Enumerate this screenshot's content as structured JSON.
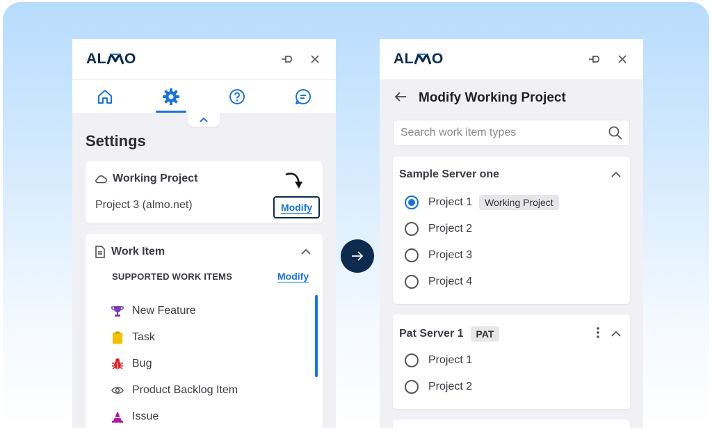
{
  "brand": {
    "logo_text_left": "AL",
    "logo_text_right": "O"
  },
  "left_panel": {
    "nav_tabs": [
      {
        "name": "home",
        "icon": "home-icon"
      },
      {
        "name": "settings",
        "icon": "gear-icon",
        "active": true
      },
      {
        "name": "help",
        "icon": "help-icon"
      },
      {
        "name": "chat",
        "icon": "chat-icon"
      }
    ],
    "page_title": "Settings",
    "working_project": {
      "header": "Working Project",
      "value": "Project 3 (almo.net)",
      "modify_label": "Modify"
    },
    "work_item": {
      "header": "Work Item",
      "supported_label": "SUPPORTED WORK ITEMS",
      "modify_label": "Modify",
      "items": [
        {
          "label": "New Feature",
          "icon": "trophy-icon",
          "color": "#7b3fb5"
        },
        {
          "label": "Task",
          "icon": "clipboard-icon",
          "color": "#f2c200"
        },
        {
          "label": "Bug",
          "icon": "bug-icon",
          "color": "#e0262b"
        },
        {
          "label": "Product Backlog Item",
          "icon": "eye-icon",
          "color": "#555555"
        },
        {
          "label": "Issue",
          "icon": "cone-icon",
          "color": "#b3179a"
        }
      ]
    }
  },
  "right_panel": {
    "title": "Modify Working Project",
    "search_placeholder": "Search work item types",
    "servers": [
      {
        "name": "Sample Server one",
        "projects": [
          {
            "label": "Project 1",
            "selected": true,
            "badge": "Working Project"
          },
          {
            "label": "Project 2",
            "selected": false
          },
          {
            "label": "Project 3",
            "selected": false
          },
          {
            "label": "Project 4",
            "selected": false
          }
        ]
      },
      {
        "name": "Pat Server 1",
        "badge": "PAT",
        "projects": [
          {
            "label": "Project 1",
            "selected": false
          },
          {
            "label": "Project 2",
            "selected": false
          }
        ]
      }
    ]
  },
  "colors": {
    "accent": "#1a73d9",
    "navy": "#0d2b4f",
    "panel_bg": "#f1f0f5"
  }
}
